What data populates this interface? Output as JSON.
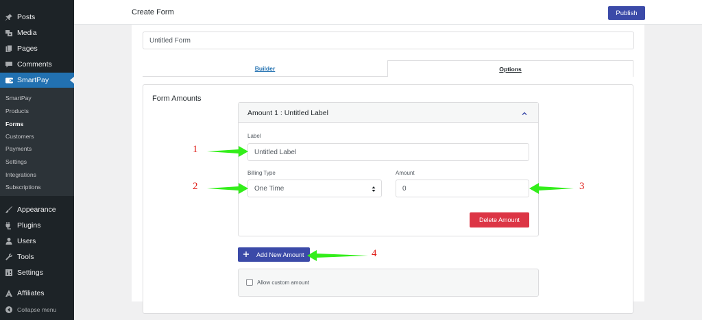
{
  "sidebar": {
    "top_items": [
      {
        "label": "Posts",
        "icon": "pushpin-icon"
      },
      {
        "label": "Media",
        "icon": "media-icon"
      },
      {
        "label": "Pages",
        "icon": "pages-icon"
      },
      {
        "label": "Comments",
        "icon": "comment-icon"
      },
      {
        "label": "SmartPay",
        "icon": "wallet-icon",
        "active": true
      }
    ],
    "submenu": [
      "SmartPay",
      "Products",
      "Forms",
      "Customers",
      "Payments",
      "Settings",
      "Integrations",
      "Subscriptions"
    ],
    "submenu_current": "Forms",
    "bottom_items": [
      {
        "label": "Appearance",
        "icon": "paintbrush-icon"
      },
      {
        "label": "Plugins",
        "icon": "plug-icon"
      },
      {
        "label": "Users",
        "icon": "user-icon"
      },
      {
        "label": "Tools",
        "icon": "wrench-icon"
      },
      {
        "label": "Settings",
        "icon": "settings-icon"
      },
      {
        "label": "Affiliates",
        "icon": "affiliates-icon"
      }
    ],
    "collapse_label": "Collapse menu"
  },
  "header": {
    "title": "Create Form",
    "publish_label": "Publish"
  },
  "form": {
    "title_value": "Untitled Form",
    "tabs": [
      {
        "label": "Builder",
        "active": false
      },
      {
        "label": "Options",
        "active": true
      }
    ],
    "section_title": "Form Amounts",
    "amount_card": {
      "title": "Amount 1 : Untitled Label",
      "label_field": {
        "label": "Label",
        "value": "Untitled Label"
      },
      "billing_type": {
        "label": "Billing Type",
        "value": "One Time"
      },
      "amount": {
        "label": "Amount",
        "value": "0"
      },
      "delete_label": "Delete Amount"
    },
    "add_amount_label": "Add New Amount",
    "allow_custom_label": "Allow custom amount",
    "allow_custom_checked": false
  },
  "annotations": [
    "1",
    "2",
    "3",
    "4"
  ],
  "colors": {
    "sidebar_bg": "#1d2327",
    "active_menu": "#2271b1",
    "primary_button": "#3b4aa8",
    "delete_button": "#dc3545",
    "annotation_number": "#e0201b",
    "annotation_arrow": "#33ee1a"
  }
}
